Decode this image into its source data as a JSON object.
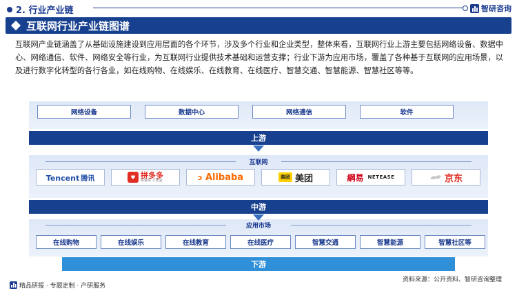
{
  "header": {
    "section": "2. 行业产业链",
    "brand": "智研咨询"
  },
  "title": "互联网行业产业链图谱",
  "intro": "互联网产业链涵盖了从基础设施建设到应用层面的各个环节，涉及多个行业和企业类型，整体来看，互联网行业上游主要包括网络设备、数据中心、网络通信、软件、网络安全等行业，为互联网行业提供技术基础和运营支撑；行业下游为应用市场，覆盖了各种基于互联网的应用场景，以及进行数字化转型的各行各业，如在线购物、在线娱乐、在线教育、在线医疗、智慧交通、智慧能源、智慧社区等等。",
  "upstream": {
    "items": [
      "网络设备",
      "数据中心",
      "网络通信",
      "软件"
    ],
    "label": "上游"
  },
  "midstream": {
    "sublabel": "互联网",
    "companies": [
      {
        "name": "Tencent",
        "cn": "腾讯",
        "icon": "tencent-logo"
      },
      {
        "name": "拼多多",
        "slogan": "拼着买 才便宜",
        "icon": "pinduoduo-logo"
      },
      {
        "name": "Alibaba",
        "icon": "alibaba-logo"
      },
      {
        "name": "美团",
        "tag": "美团",
        "icon": "meituan-logo"
      },
      {
        "name": "網易",
        "en": "NETEASE",
        "icon": "netease-logo"
      },
      {
        "name": "京东",
        "icon": "jd-logo"
      }
    ],
    "label": "中游"
  },
  "downstream": {
    "sublabel": "应用市场",
    "items": [
      "在线购物",
      "在线娱乐",
      "在线教育",
      "在线医疗",
      "智慧交通",
      "智慧能源",
      "智慧社区等"
    ],
    "label": "下游"
  },
  "footer": {
    "left": "精品研报 · 专题定制 · 产研服务",
    "right": "资料来源：公开资料、智研咨询整理"
  },
  "colors": {
    "primary": "#17408f",
    "downstream_bar": "#2f8fd8",
    "band": "#e4ecf8"
  }
}
